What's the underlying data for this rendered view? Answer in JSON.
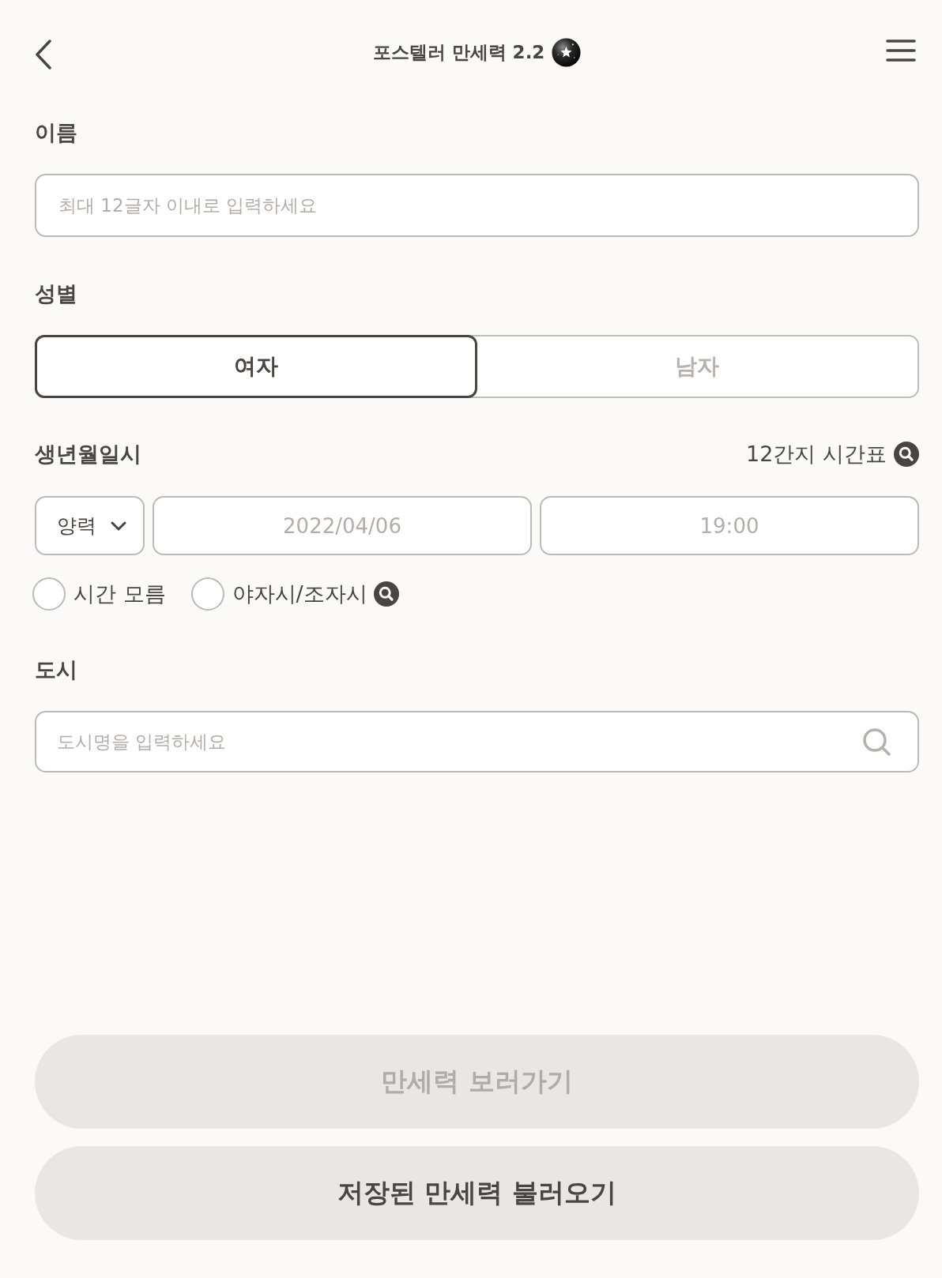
{
  "header": {
    "title": "포스텔러 만세력 2.2"
  },
  "name_section": {
    "label": "이름",
    "field": {
      "placeholder": "최대 12글자 이내로 입력하세요"
    }
  },
  "gender_section": {
    "label": "성별",
    "options": [
      {
        "label": "여자",
        "selected": true
      },
      {
        "label": "남자",
        "selected": false
      }
    ]
  },
  "birth_section": {
    "label": "생년월일시",
    "link": {
      "label": "12간지 시간표"
    },
    "calendar": {
      "value": "양력"
    },
    "date_field": {
      "placeholder": "2022/04/06"
    },
    "time_field": {
      "placeholder": "19:00"
    },
    "options": [
      {
        "label": "시간 모름",
        "checked": false,
        "info": false
      },
      {
        "label": "야자시/조자시",
        "checked": false,
        "info": true
      }
    ]
  },
  "city_section": {
    "label": "도시",
    "field": {
      "placeholder": "도시명을 입력하세요"
    }
  },
  "buttons": [
    {
      "label": "만세력 보러가기",
      "disabled": true
    },
    {
      "label": "저장된 만세력 불러오기",
      "disabled": false
    }
  ]
}
